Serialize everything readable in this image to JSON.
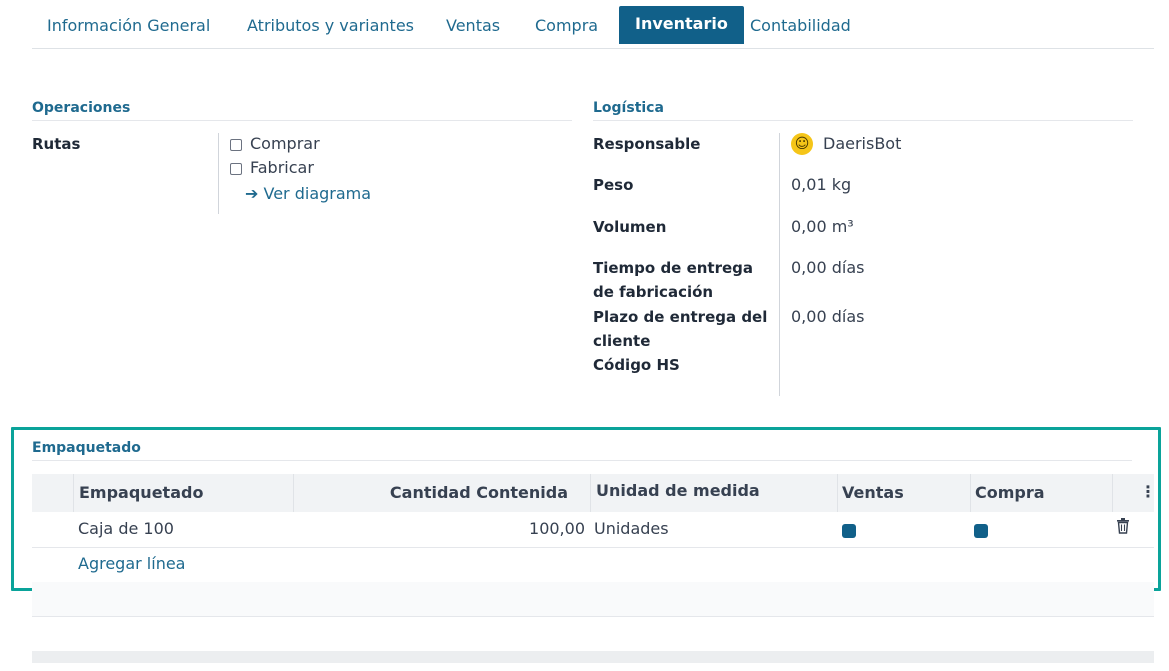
{
  "tabs": [
    {
      "label": "Información General",
      "active": false
    },
    {
      "label": "Atributos y variantes",
      "active": false
    },
    {
      "label": "Ventas",
      "active": false
    },
    {
      "label": "Compra",
      "active": false
    },
    {
      "label": "Inventario",
      "active": true
    },
    {
      "label": "Contabilidad",
      "active": false
    }
  ],
  "operations": {
    "title": "Operaciones",
    "routes_label": "Rutas",
    "routes": [
      {
        "label": "Comprar",
        "checked": false
      },
      {
        "label": "Fabricar",
        "checked": false
      }
    ],
    "diagram_link": "Ver diagrama"
  },
  "logistics": {
    "title": "Logística",
    "responsible_label": "Responsable",
    "responsible_value": "DaerisBot",
    "weight_label": "Peso",
    "weight_value": "0,01",
    "weight_unit": "kg",
    "volume_label": "Volumen",
    "volume_value": "0,00",
    "volume_unit": "m³",
    "mfg_lead_label_1": "Tiempo de entrega",
    "mfg_lead_label_2": "de fabricación",
    "mfg_lead_value": "0,00",
    "mfg_lead_unit": "días",
    "customer_lead_label_1": "Plazo de entrega del",
    "customer_lead_label_2": "cliente",
    "customer_lead_value": "0,00",
    "customer_lead_unit": "días",
    "hs_code_label": "Código HS"
  },
  "packaging": {
    "title": "Empaquetado",
    "columns": {
      "name": "Empaquetado",
      "qty": "Cantidad Contenida",
      "uom": "Unidad de medida",
      "sales": "Ventas",
      "purchase": "Compra"
    },
    "rows": [
      {
        "name": "Caja de 100",
        "qty": "100,00",
        "uom": "Unidades",
        "sales": true,
        "purchase": true
      }
    ],
    "add_line": "Agregar línea"
  },
  "colors": {
    "accent": "#116089",
    "link": "#1f6a8f",
    "highlight": "#0aa39a"
  }
}
